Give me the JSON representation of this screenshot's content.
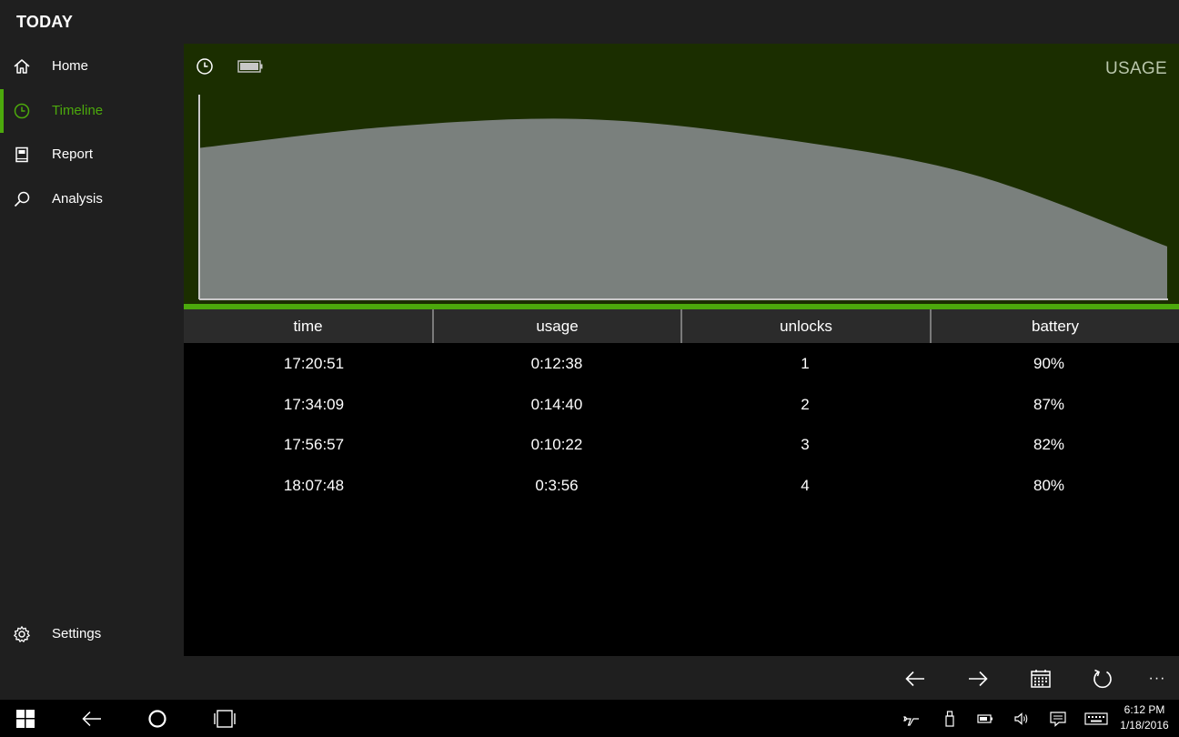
{
  "app": {
    "title": "TODAY"
  },
  "sidebar": {
    "items": [
      {
        "label": "Home",
        "icon": "home-icon",
        "active": false
      },
      {
        "label": "Timeline",
        "icon": "clock-icon",
        "active": true
      },
      {
        "label": "Report",
        "icon": "book-icon",
        "active": false
      },
      {
        "label": "Analysis",
        "icon": "magnifier-icon",
        "active": false
      }
    ],
    "settings": {
      "label": "Settings",
      "icon": "gear-icon"
    }
  },
  "chart_header": {
    "title": "USAGE",
    "icons": [
      "clock-icon",
      "battery-icon"
    ]
  },
  "chart_data": {
    "type": "area",
    "title": "USAGE",
    "xlabel": "",
    "ylabel": "",
    "grid": false,
    "legend": "none",
    "series": [
      {
        "values": [
          0.84,
          0.96,
          1.0,
          0.89,
          0.69,
          0.29
        ]
      }
    ],
    "fill_color": "#7a807d",
    "stroke_color": "#c8c8c8"
  },
  "table": {
    "columns": [
      "time",
      "usage",
      "unlocks",
      "battery"
    ],
    "rows": [
      [
        "17:20:51",
        "0:12:38",
        "1",
        "90%"
      ],
      [
        "17:34:09",
        "0:14:40",
        "2",
        "87%"
      ],
      [
        "17:56:57",
        "0:10:22",
        "3",
        "82%"
      ],
      [
        "18:07:48",
        "0:3:56",
        "4",
        "80%"
      ]
    ]
  },
  "appbar": {
    "buttons": [
      "back-arrow-icon",
      "forward-arrow-icon",
      "calendar-icon",
      "refresh-icon",
      "more-icon"
    ],
    "more_label": "···"
  },
  "taskbar": {
    "time": "6:12 PM",
    "date": "1/18/2016"
  },
  "colors": {
    "accent": "#4ca90c",
    "chart_bg": "#1b2e00",
    "panel": "#1f1f1f",
    "header": "#2b2b2b"
  }
}
